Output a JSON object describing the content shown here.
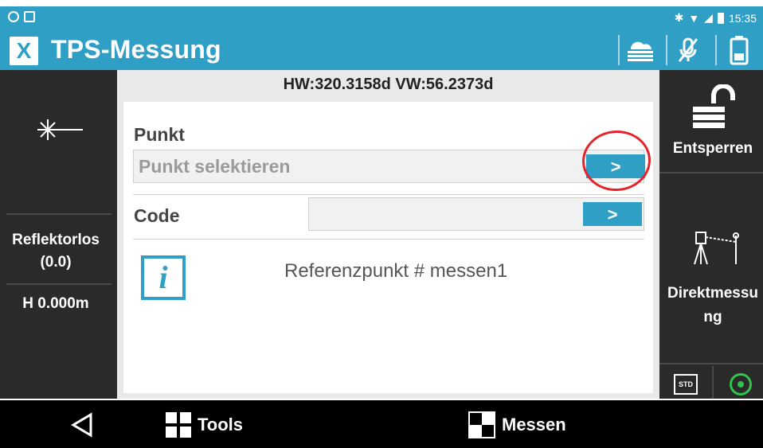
{
  "status_bar": {
    "time": "15:35"
  },
  "header": {
    "title": "TPS-Messung",
    "logo_letter": "X"
  },
  "angles": "HW:320.3158d  VW:56.2373d",
  "left_rail": {
    "mode_line1": "Reflektorlos",
    "mode_line2": "(0.0)",
    "height": "H 0.000m"
  },
  "right_rail": {
    "unlock_label": "Entsperren",
    "direct_label_line1": "Direktmessu",
    "direct_label_line2": "ng",
    "std_label": "STD"
  },
  "form": {
    "punkt_label": "Punkt",
    "punkt_placeholder": "Punkt selektieren",
    "code_label": "Code",
    "code_value": "",
    "arrow": ">",
    "info_icon": "i",
    "info_text": "Referenzpunkt # messen1"
  },
  "nav": {
    "tools_label": "Tools",
    "messen_label": "Messen"
  },
  "colors": {
    "accent": "#2f9fc5",
    "rail_bg": "#2a2a2a",
    "annotation": "#e4242b",
    "status_ok": "#32c24d"
  }
}
